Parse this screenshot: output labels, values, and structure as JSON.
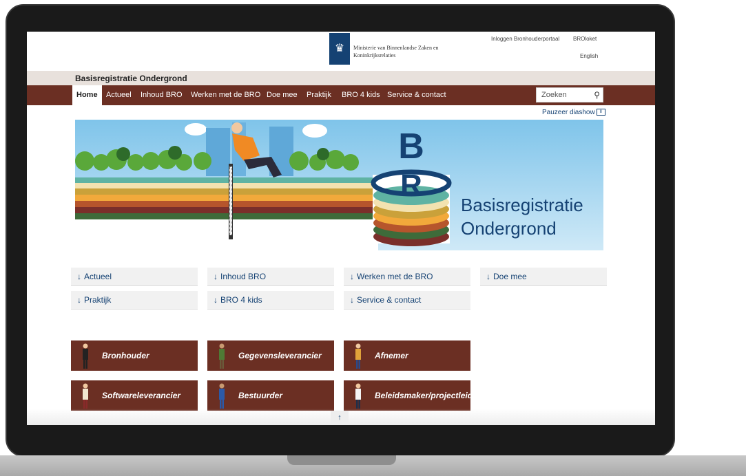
{
  "header": {
    "ministry_name": "Ministerie van Binnenlandse Zaken en Koninkrijksrelaties",
    "login_link": "Inloggen Bronhouderportaal",
    "broloket_link": "BROloket",
    "language_link": "English",
    "site_title": "Basisregistratie Ondergrond"
  },
  "nav": {
    "items": [
      "Home",
      "Actueel",
      "Inhoud BRO",
      "Werken met de BRO",
      "Doe mee",
      "Praktijk",
      "BRO 4 kids",
      "Service & contact"
    ],
    "active": "Home"
  },
  "search": {
    "placeholder": "Zoeken",
    "icon": "search-icon"
  },
  "slideshow": {
    "pause_label": "Pauzeer diashow",
    "pause_icon": "pause-icon"
  },
  "banner": {
    "logo_letters": [
      "B",
      "R"
    ],
    "title_line1": "Basisregistratie",
    "title_line2": "Ondergrond"
  },
  "quicklinks": [
    "Actueel",
    "Inhoud BRO",
    "Werken met de BRO",
    "Doe mee",
    "Praktijk",
    "BRO 4 kids",
    "Service & contact"
  ],
  "quicklink_arrow": "↓",
  "roles": [
    "Bronhouder",
    "Gegevensleverancier",
    "Afnemer",
    "Softwareleverancier",
    "Bestuurder",
    "Beleidsmaker/projectleider"
  ],
  "scroll_top": "↑",
  "colors": {
    "brand_brown": "#6b2f23",
    "rijk_blue": "#154273",
    "title_bar": "#e8e1dc"
  }
}
